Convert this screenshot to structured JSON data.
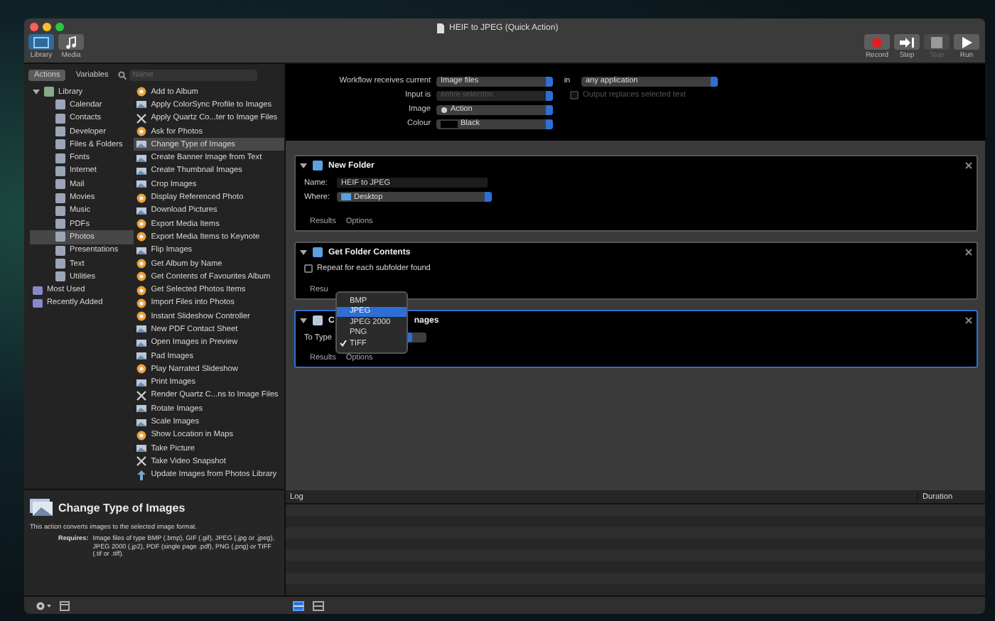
{
  "window": {
    "title": "HEIF to JPEG (Quick Action)"
  },
  "toolbar": {
    "left": [
      {
        "label": "Library",
        "selected": true
      },
      {
        "label": "Media",
        "selected": false
      }
    ],
    "right": [
      {
        "label": "Record",
        "kind": "record",
        "disabled": false
      },
      {
        "label": "Step",
        "kind": "step",
        "disabled": false
      },
      {
        "label": "Stop",
        "kind": "stop",
        "disabled": true
      },
      {
        "label": "Run",
        "kind": "run",
        "disabled": false
      }
    ]
  },
  "library_tabs": [
    {
      "label": "Actions",
      "selected": true
    },
    {
      "label": "Variables",
      "selected": false
    }
  ],
  "search": {
    "placeholder": "Name"
  },
  "library": [
    {
      "label": "Library",
      "expanded": true,
      "selected": false,
      "children": [
        {
          "label": "Calendar",
          "selected": false
        },
        {
          "label": "Contacts",
          "selected": false
        },
        {
          "label": "Developer",
          "selected": false
        },
        {
          "label": "Files & Folders",
          "selected": false
        },
        {
          "label": "Fonts",
          "selected": false
        },
        {
          "label": "Internet",
          "selected": false
        },
        {
          "label": "Mail",
          "selected": false
        },
        {
          "label": "Movies",
          "selected": false
        },
        {
          "label": "Music",
          "selected": false
        },
        {
          "label": "PDFs",
          "selected": false
        },
        {
          "label": "Photos",
          "selected": true
        },
        {
          "label": "Presentations",
          "selected": false
        },
        {
          "label": "Text",
          "selected": false
        },
        {
          "label": "Utilities",
          "selected": false
        }
      ]
    },
    {
      "label": "Most Used",
      "selected": false
    },
    {
      "label": "Recently Added",
      "selected": false
    }
  ],
  "actions": [
    {
      "label": "Add to Album",
      "kind": "photos",
      "selected": false
    },
    {
      "label": "Apply ColorSync Profile to Images",
      "kind": "image",
      "selected": false
    },
    {
      "label": "Apply Quartz Co...ter to Image Files",
      "kind": "tool",
      "selected": false
    },
    {
      "label": "Ask for Photos",
      "kind": "photos",
      "selected": false
    },
    {
      "label": "Change Type of Images",
      "kind": "image",
      "selected": true
    },
    {
      "label": "Create Banner Image from Text",
      "kind": "image",
      "selected": false
    },
    {
      "label": "Create Thumbnail Images",
      "kind": "image",
      "selected": false
    },
    {
      "label": "Crop Images",
      "kind": "image",
      "selected": false
    },
    {
      "label": "Display Referenced Photo",
      "kind": "photos",
      "selected": false
    },
    {
      "label": "Download Pictures",
      "kind": "image",
      "selected": false
    },
    {
      "label": "Export Media Items",
      "kind": "photos",
      "selected": false
    },
    {
      "label": "Export Media Items to Keynote",
      "kind": "photos",
      "selected": false
    },
    {
      "label": "Flip Images",
      "kind": "image",
      "selected": false
    },
    {
      "label": "Get Album by Name",
      "kind": "photos",
      "selected": false
    },
    {
      "label": "Get Contents of Favourites Album",
      "kind": "photos",
      "selected": false
    },
    {
      "label": "Get Selected Photos Items",
      "kind": "photos",
      "selected": false
    },
    {
      "label": "Import Files into Photos",
      "kind": "photos",
      "selected": false
    },
    {
      "label": "Instant Slideshow Controller",
      "kind": "photos",
      "selected": false
    },
    {
      "label": "New PDF Contact Sheet",
      "kind": "image",
      "selected": false
    },
    {
      "label": "Open Images in Preview",
      "kind": "image",
      "selected": false
    },
    {
      "label": "Pad Images",
      "kind": "image",
      "selected": false
    },
    {
      "label": "Play Narrated Slideshow",
      "kind": "photos",
      "selected": false
    },
    {
      "label": "Print Images",
      "kind": "image",
      "selected": false
    },
    {
      "label": "Render Quartz C...ns to Image Files",
      "kind": "tool",
      "selected": false
    },
    {
      "label": "Rotate Images",
      "kind": "image",
      "selected": false
    },
    {
      "label": "Scale Images",
      "kind": "image",
      "selected": false
    },
    {
      "label": "Show Location in Maps",
      "kind": "photos",
      "selected": false
    },
    {
      "label": "Take Picture",
      "kind": "image",
      "selected": false
    },
    {
      "label": "Take Video Snapshot",
      "kind": "tool",
      "selected": false
    },
    {
      "label": "Update Images from Photos Library",
      "kind": "update",
      "selected": false
    }
  ],
  "description": {
    "title": "Change Type of Images",
    "summary": "This action converts images to the selected image format.",
    "requires_label": "Requires:",
    "requires": "Image files of type BMP (.bmp), GIF (.gif), JPEG (.jpg or .jpeg), JPEG 2000 (.jp2), PDF (single page .pdf), PNG (.png) or TIFF (.tif or .tiff)."
  },
  "workflow_header": {
    "receives_label": "Workflow receives current",
    "receives": "Image files",
    "in_label": "in",
    "application": "any application",
    "input_label": "Input is",
    "input": "entire selection",
    "input_disabled": true,
    "output_replaces": {
      "label": "Output replaces selected text",
      "checked": false,
      "disabled": true
    },
    "image_label": "Image",
    "image": "Action",
    "colour_label": "Colour",
    "colour": "Black"
  },
  "cards": [
    {
      "kind": "new_folder",
      "title": "New Folder",
      "selected": false,
      "name_label": "Name:",
      "name": "HEIF to JPEG",
      "where_label": "Where:",
      "where": "Desktop",
      "footer": [
        "Results",
        "Options"
      ]
    },
    {
      "kind": "folder_contents",
      "title": "Get Folder Contents",
      "selected": false,
      "checkbox": {
        "label": "Repeat for each subfolder found",
        "checked": false
      },
      "footer": [
        "Resu"
      ]
    },
    {
      "kind": "change_type",
      "title_parts": [
        "C",
        "nages"
      ],
      "selected": true,
      "type_label": "To Type",
      "footer": [
        "Results",
        "Options"
      ]
    }
  ],
  "type_menu": [
    {
      "label": "BMP",
      "selected": false,
      "checked": false
    },
    {
      "label": "JPEG",
      "selected": true,
      "checked": false
    },
    {
      "label": "JPEG 2000",
      "selected": false,
      "checked": false
    },
    {
      "label": "PNG",
      "selected": false,
      "checked": false
    },
    {
      "label": "TIFF",
      "selected": false,
      "checked": true
    }
  ],
  "log": {
    "columns": [
      "Log",
      "Duration"
    ]
  },
  "bottom_views": [
    {
      "selected": true
    },
    {
      "selected": false
    }
  ]
}
